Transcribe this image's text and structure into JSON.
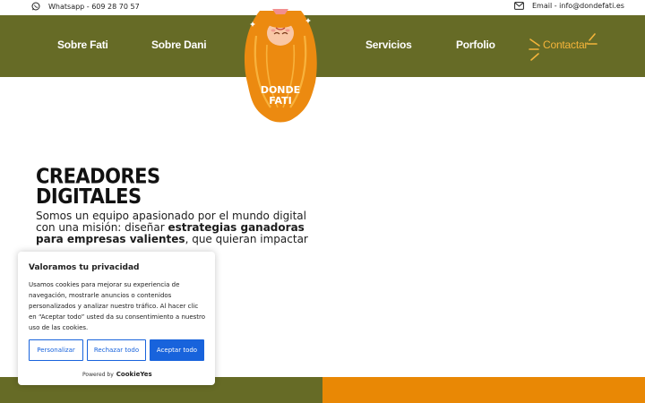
{
  "topbar": {
    "whatsapp_text": "Whatsapp - 609 28 70 57",
    "email_text": "Email - info@dondefati.es"
  },
  "nav": {
    "items": [
      {
        "label": "Sobre Fati"
      },
      {
        "label": "Sobre Dani"
      },
      {
        "label": "Servicios"
      },
      {
        "label": "Porfolio"
      },
      {
        "label": "Contactar"
      }
    ]
  },
  "logo": {
    "line1": "DONDE",
    "line2": "FATI"
  },
  "hero": {
    "title_line1": "CREADORES",
    "title_line2": "DIGITALES",
    "text_part1": "Somos un equipo apasionado por el mundo digital con una misión: diseñar ",
    "text_bold": "estrategias ganadoras para empresas valientes",
    "text_part2": ", que quieran impactar"
  },
  "cookie": {
    "title": "Valoramos tu privacidad",
    "description": "Usamos cookies para mejorar su experiencia de navegación, mostrarle anuncios o contenidos personalizados y analizar nuestro tráfico. Al hacer clic en “Aceptar todo” usted da su consentimiento a nuestro uso de las cookies.",
    "btn_customize": "Personalizar",
    "btn_reject": "Rechazar todo",
    "btn_accept": "Aceptar todo",
    "powered_by": "Powered by",
    "brand": "CookieYes"
  },
  "colors": {
    "header_bg": "#666b26",
    "accent_orange": "#e98805",
    "active_link": "#f4b43a",
    "cookie_blue": "#1863dc"
  }
}
